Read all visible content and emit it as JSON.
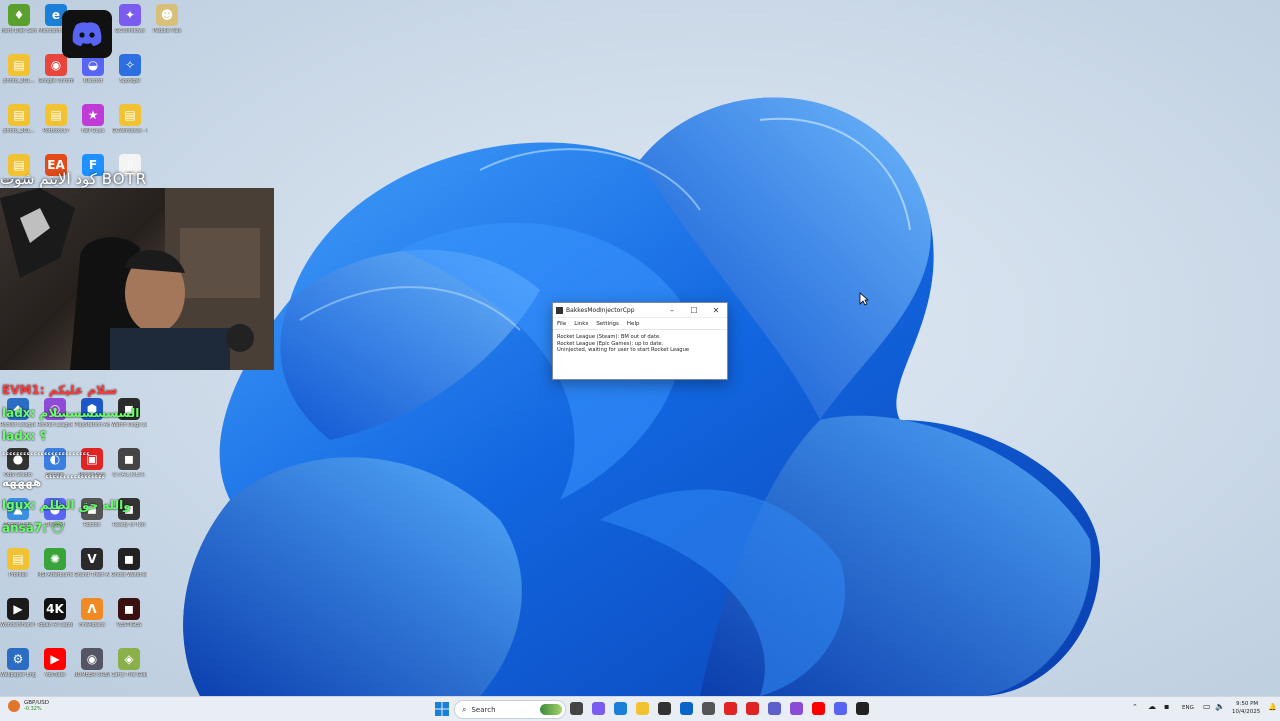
{
  "desktop_icons": [
    {
      "label": "Hard Disk Sentinel",
      "color": "#5aa02c",
      "glyph": "♦",
      "col": 0,
      "row": 0
    },
    {
      "label": "Microsoft Edge",
      "color": "#1a7fd6",
      "glyph": "e",
      "col": 1,
      "row": 0
    },
    {
      "label": "GCWindows",
      "color": "#7a5cf0",
      "glyph": "✦",
      "col": 3,
      "row": 0
    },
    {
      "label": "Paddle Pals",
      "color": "#d9c07a",
      "glyph": "☻",
      "col": 4,
      "row": 0
    },
    {
      "label": "photo_201...",
      "color": "#f1c232",
      "glyph": "▤",
      "col": 0,
      "row": 1
    },
    {
      "label": "Google Chrome",
      "color": "#e8453c",
      "glyph": "◉",
      "col": 1,
      "row": 1
    },
    {
      "label": "Discord",
      "color": "#5865f2",
      "glyph": "◒",
      "col": 2,
      "row": 1
    },
    {
      "label": "Spotigal",
      "color": "#2d6fe0",
      "glyph": "✧",
      "col": 3,
      "row": 1
    },
    {
      "label": "photo_201...",
      "color": "#f1c232",
      "glyph": "▤",
      "col": 0,
      "row": 2
    },
    {
      "label": "PotBoxs17",
      "color": "#f1c232",
      "glyph": "▤",
      "col": 1,
      "row": 2
    },
    {
      "label": "Fall Guys",
      "color": "#c03ad6",
      "glyph": "★",
      "col": 2,
      "row": 2
    },
    {
      "label": "GCWindows - Copy",
      "color": "#f1c232",
      "glyph": "▤",
      "col": 3,
      "row": 2
    },
    {
      "label": "photo_201...",
      "color": "#f1c232",
      "glyph": "▤",
      "col": 0,
      "row": 3
    },
    {
      "label": "EA",
      "color": "#e24a1a",
      "glyph": "EA",
      "col": 1,
      "row": 3
    },
    {
      "label": "",
      "color": "#1e90ff",
      "glyph": "F",
      "col": 2,
      "row": 3
    },
    {
      "label": "",
      "color": "#f4f4f4",
      "glyph": "▯",
      "col": 3,
      "row": 3
    }
  ],
  "lower_icons": [
    {
      "label": "Rocket League",
      "color": "#2b6cc4",
      "glyph": "◆",
      "col": 0,
      "row": 0
    },
    {
      "label": "Rocket League",
      "color": "#8f4bd6",
      "glyph": "◎",
      "col": 1,
      "row": 0
    },
    {
      "label": "PlayStation Accessories",
      "color": "#1d58c9",
      "glyph": "⬢",
      "col": 2,
      "row": 0
    },
    {
      "label": "Watch Dogs Legion",
      "color": "#2c2c2c",
      "glyph": "◼",
      "col": 3,
      "row": 0
    },
    {
      "label": "OBS Studio",
      "color": "#333",
      "glyph": "●",
      "col": 0,
      "row": 1
    },
    {
      "label": "Google",
      "color": "#3a7ee0",
      "glyph": "◐",
      "col": 1,
      "row": 1
    },
    {
      "label": "PowerToys",
      "color": "#e02424",
      "glyph": "▣",
      "col": 2,
      "row": 1
    },
    {
      "label": "S.T.A.L.K.E.R.",
      "color": "#444",
      "glyph": "◼",
      "col": 3,
      "row": 1
    },
    {
      "label": "Rocket Lite",
      "color": "#3b8fe0",
      "glyph": "▲",
      "col": 0,
      "row": 2
    },
    {
      "label": "Discord",
      "color": "#5865f2",
      "glyph": "◒",
      "col": 1,
      "row": 2
    },
    {
      "label": "Roblox",
      "color": "#555",
      "glyph": "◼",
      "col": 2,
      "row": 2
    },
    {
      "label": "Ready or Not",
      "color": "#333",
      "glyph": "◼",
      "col": 3,
      "row": 2
    },
    {
      "label": "Profiles",
      "color": "#f1c232",
      "glyph": "▤",
      "col": 0,
      "row": 3
    },
    {
      "label": "MSI Afterburner",
      "color": "#3aa43a",
      "glyph": "✺",
      "col": 1,
      "row": 3
    },
    {
      "label": "Grand Theft Auto V",
      "color": "#2a2a2a",
      "glyph": "V",
      "col": 2,
      "row": 3
    },
    {
      "label": "Ghost Watchers",
      "color": "#222",
      "glyph": "◼",
      "col": 3,
      "row": 3
    },
    {
      "label": "Wondershare Filmora 13",
      "color": "#1a1a1a",
      "glyph": "▶",
      "col": 0,
      "row": 4
    },
    {
      "label": "Topaz AI Capture",
      "color": "#111",
      "glyph": "4K",
      "col": 1,
      "row": 4
    },
    {
      "label": "FireAlpaca",
      "color": "#f08a24",
      "glyph": "Λ",
      "col": 2,
      "row": 4
    },
    {
      "label": "VESTIGES",
      "color": "#3a1010",
      "glyph": "◼",
      "col": 3,
      "row": 4
    },
    {
      "label": "Wallpaper Engine",
      "color": "#2b6cc4",
      "glyph": "⚙",
      "col": 0,
      "row": 5
    },
    {
      "label": "YouTube",
      "color": "#ff0000",
      "glyph": "▶",
      "col": 1,
      "row": 5
    },
    {
      "label": "BOMBER CREW",
      "color": "#556",
      "glyph": "◉",
      "col": 2,
      "row": 5
    },
    {
      "label": "Carry The Glass",
      "color": "#8ab04a",
      "glyph": "◈",
      "col": 3,
      "row": 5
    }
  ],
  "overlay": {
    "chat_title": "كود الايتم شوب BOTR",
    "chat_lines": [
      {
        "text": "EVM1: سلام عليكم",
        "color": "#ff3b3b"
      },
      {
        "text": "ladx: السسسسسسلام",
        "color": "#66ff66"
      },
      {
        "text": "ladx: ؟",
        "color": "#66ff66"
      },
      {
        "text": "ٴٴٴٴٴٴٴٴٴٴٴٴٴٴٴٴٴٴٴٴٴٴٴٴٴ",
        "color": "#ffffff"
      },
      {
        "text": "ٴٴٴٴٴٴٴٴٴٴٴٴٴٴٴٴٴ ههههه",
        "color": "#ffffff"
      },
      {
        "text": "lgux: والله حق الظلم",
        "color": "#66ff66"
      },
      {
        "text": "ansa7: 😶",
        "color": "#66ff66"
      }
    ]
  },
  "window": {
    "title": "BakkesModInjectorCpp",
    "menu": [
      "File",
      "Links",
      "Settings",
      "Help"
    ],
    "lines": [
      "Rocket League (Steam): BM out of date.",
      "Rocket League (Epic Games): up to date.",
      "Uninjected, waiting for user to start Rocket League"
    ],
    "controls": {
      "minimize": "–",
      "maximize": "☐",
      "close": "✕"
    }
  },
  "taskbar": {
    "widget_label": "GBP/USD",
    "widget_value": "-0.32%",
    "search_placeholder": "Search",
    "language": "ENG",
    "time": "9:50 PM",
    "date": "10/4/2025",
    "apps": [
      {
        "name": "task-view-icon",
        "color": "#444"
      },
      {
        "name": "copilot-icon",
        "color": "#7a5cf0"
      },
      {
        "name": "edge-icon",
        "color": "#1a7fd6"
      },
      {
        "name": "file-explorer-icon",
        "color": "#f1c232"
      },
      {
        "name": "store-icon",
        "color": "#333"
      },
      {
        "name": "outlook-icon",
        "color": "#0a64c8"
      },
      {
        "name": "settings-icon",
        "color": "#555"
      },
      {
        "name": "youtube-icon",
        "color": "#e02424"
      },
      {
        "name": "media-icon",
        "color": "#e02424"
      },
      {
        "name": "teams-icon",
        "color": "#5b5fc7"
      },
      {
        "name": "twitch-icon",
        "color": "#8a4bd6"
      },
      {
        "name": "youtube-icon-2",
        "color": "#ff0000"
      },
      {
        "name": "discord-icon",
        "color": "#5865f2"
      },
      {
        "name": "bakkesmod-icon",
        "color": "#222"
      }
    ]
  }
}
